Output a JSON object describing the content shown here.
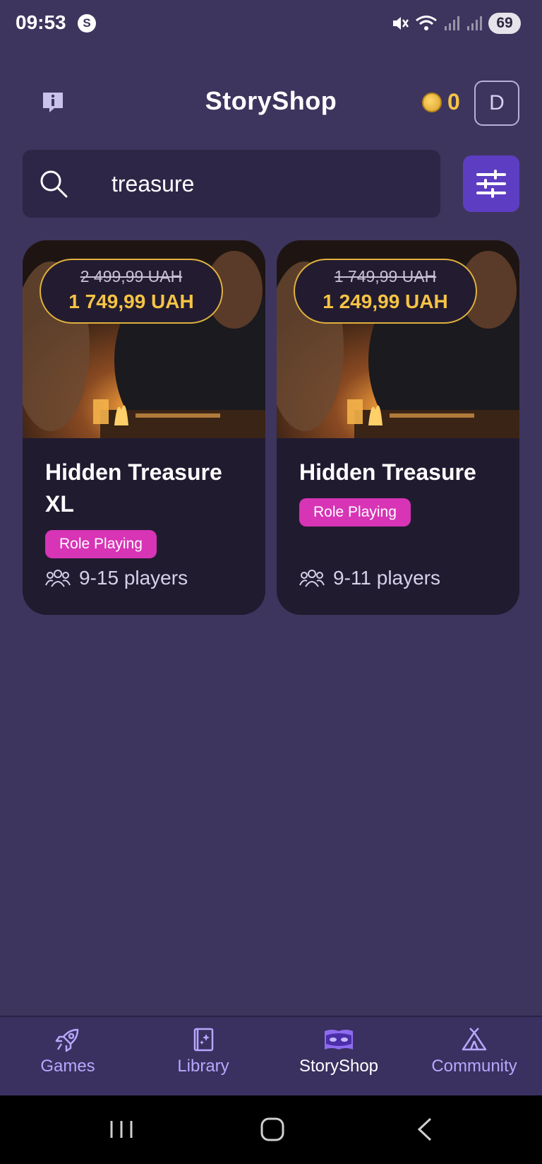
{
  "status_bar": {
    "time": "09:53",
    "battery": "69"
  },
  "header": {
    "title": "StoryShop",
    "coin_count": "0",
    "avatar_letter": "D"
  },
  "search": {
    "value": "treasure",
    "placeholder": ""
  },
  "products": [
    {
      "title": "Hidden Treasure XL",
      "old_price": "2 499,99 UAH",
      "price": "1 749,99 UAH",
      "genre": "Role Playing",
      "players": "9-15 players"
    },
    {
      "title": "Hidden Treasure",
      "old_price": "1 749,99 UAH",
      "price": "1 249,99 UAH",
      "genre": "Role Playing",
      "players": "9-11 players"
    }
  ],
  "nav": {
    "items": [
      {
        "label": "Games",
        "icon": "rocket-icon"
      },
      {
        "label": "Library",
        "icon": "book-icon"
      },
      {
        "label": "StoryShop",
        "icon": "storyshop-mask-icon",
        "active": true
      },
      {
        "label": "Community",
        "icon": "tent-icon"
      }
    ]
  },
  "colors": {
    "background": "#3e355e",
    "accent_gold": "#f6c445",
    "genre_pink": "#d734b6",
    "filter_purple": "#5d3ec2",
    "nav_label": "#b6a8ff"
  }
}
